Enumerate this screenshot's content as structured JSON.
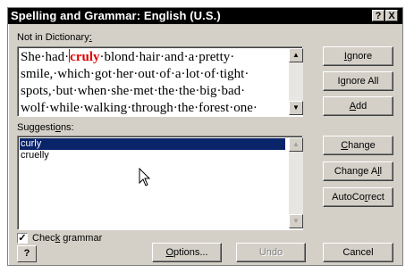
{
  "dialog": {
    "title": "Spelling and Grammar: English (U.S.)",
    "help_glyph": "?",
    "close_glyph": "X"
  },
  "not_in_dictionary": {
    "label_pre": "Not in Dictionary",
    "label_key": ":",
    "text_before": "She·had·",
    "error_word": "cruly",
    "text_after": "·blond·hair·and·a·pretty· smile,·which·got·her·out·of·a·lot·of·tight· spots,·but·when·she·met·the·the·big·bad· wolf·while·walking·through·the·forest·one·"
  },
  "suggestions": {
    "label_pre": "Suggesti",
    "label_key": "o",
    "label_post": "ns:",
    "items": [
      "curly",
      "cruelly"
    ],
    "selected_index": 0
  },
  "buttons": {
    "ignore_key": "I",
    "ignore_post": "gnore",
    "ignore_all_pre": "I",
    "ignore_all_key": "g",
    "ignore_all_post": "nore All",
    "add_key": "A",
    "add_post": "dd",
    "change_key": "C",
    "change_post": "hange",
    "change_all_pre": "Change A",
    "change_all_key": "l",
    "change_all_post": "l",
    "autocorrect_pre": "AutoCo",
    "autocorrect_key": "r",
    "autocorrect_post": "rect",
    "options_key": "O",
    "options_post": "ptions...",
    "undo": "Undo",
    "cancel": "Cancel"
  },
  "check_grammar": {
    "label_pre": "Chec",
    "label_key": "k",
    "label_post": " grammar",
    "checked": true,
    "check_glyph": "✓"
  },
  "help_button_glyph": "?"
}
